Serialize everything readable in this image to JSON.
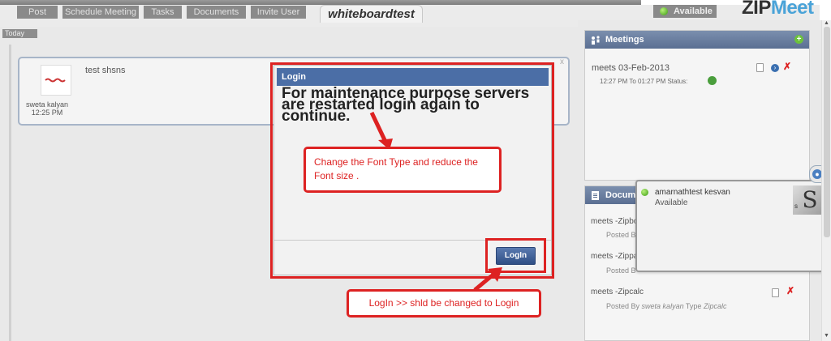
{
  "tabs": [
    {
      "label": "Post"
    },
    {
      "label": "Schedule Meeting"
    },
    {
      "label": "Tasks"
    },
    {
      "label": "Documents"
    },
    {
      "label": "Invite User"
    }
  ],
  "active_tab": "whiteboardtest",
  "header": {
    "status_label": "Available",
    "logo_part_1": "ZIP",
    "logo_part_2": "Meet"
  },
  "timeline": {
    "today_label": "Today",
    "post": {
      "author": "sweta kalyan",
      "time": "12:25 PM",
      "text": "test shsns"
    }
  },
  "modal": {
    "title": "Login",
    "message": "For maintenance purpose servers are restarted login again to continue.",
    "button_label": "LogIn",
    "close_label": "x"
  },
  "annotations": {
    "font_note": "Change the Font Type and reduce the Font size .",
    "login_note": "LogIn >> shld be changed to Login"
  },
  "meetings": {
    "header": "Meetings",
    "item_title": "meets  03-Feb-2013",
    "item_time": "12:27 PM To 01:27 PM   Status:"
  },
  "documents": {
    "header": "Docume",
    "items": [
      {
        "title": "meets -Zipbo",
        "posted": "Posted B"
      },
      {
        "title": "meets -Zippa",
        "posted": "Posted B"
      },
      {
        "title": "meets -Zipcalc",
        "posted_by_label": "Posted By",
        "author": "sweta kalyan",
        "type_label": "Type",
        "type": "Zipcalc"
      }
    ]
  },
  "user_popup": {
    "name": "amarnathtest kesvan",
    "status": "Available",
    "avatar_letter": "S",
    "avatar_small": "s"
  },
  "colors": {
    "annotation_red": "#dd2222",
    "header_blue": "#4b6ea6",
    "available_green": "#3b9b12"
  },
  "icons": {
    "status": "green-dot-icon",
    "add": "plus-circle-icon",
    "meetings": "people-icon",
    "documents": "document-icon",
    "delete": "red-x-icon",
    "go": "arrow-circle-icon",
    "chat": "person-icon"
  }
}
